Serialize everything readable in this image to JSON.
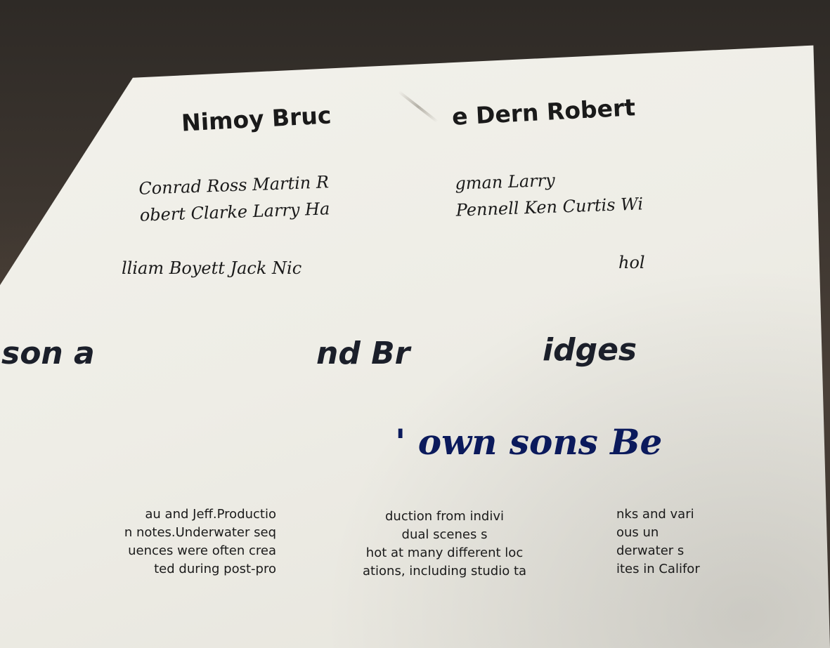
{
  "lines": {
    "l1a": "Nimoy Bruc",
    "l1b": "e Dern Robert",
    "l2a": "Conrad Ross Martin R\nobert Clarke Larry Ha",
    "l2b": "gman Larry\nPennell Ken Curtis Wi",
    "l3a": "lliam Boyett Jack Nic",
    "l3b": "hol",
    "l4a": "son a",
    "l4b": "nd Br",
    "l4c": "idges",
    "l5": "' own sons Be",
    "c1": "au and Jeff.Productio\nn notes.Underwater seq\nuences were often crea\nted during post-pro",
    "c2": "duction from indivi\ndual scenes s\nhot at many different loc\nations, including studio ta",
    "c3": "nks and vari\nous un\nderwater s\nites in Califor"
  },
  "colors": {
    "paper": "#f0efe8",
    "ink": "#1a1a1a",
    "blue_ink": "#0b1a5c",
    "background": "#3a3530"
  }
}
